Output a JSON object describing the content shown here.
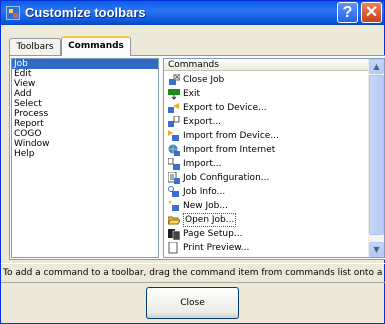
{
  "window": {
    "title": "Customize toolbars",
    "help_glyph": "?",
    "close_glyph": "✕"
  },
  "tabs": [
    {
      "label": "Toolbars",
      "selected": false
    },
    {
      "label": "Commands",
      "selected": true
    }
  ],
  "categories": {
    "items": [
      "Job",
      "Edit",
      "View",
      "Add",
      "Select",
      "Process",
      "Report",
      "COGO",
      "Window",
      "Help"
    ],
    "selected": "Job"
  },
  "commands": {
    "header": "Commands",
    "items": [
      {
        "label": "Close Job",
        "icon": "close-job-icon"
      },
      {
        "label": "Exit",
        "icon": "exit-icon"
      },
      {
        "label": "Export to Device...",
        "icon": "export-to-device-icon"
      },
      {
        "label": "Export...",
        "icon": "export-icon"
      },
      {
        "label": "Import from Device...",
        "icon": "import-from-device-icon"
      },
      {
        "label": "Import from Internet",
        "icon": "import-from-internet-icon"
      },
      {
        "label": "Import...",
        "icon": "import-icon"
      },
      {
        "label": "Job Configuration...",
        "icon": "job-configuration-icon"
      },
      {
        "label": "Job Info...",
        "icon": "job-info-icon"
      },
      {
        "label": "New Job...",
        "icon": "new-job-icon"
      },
      {
        "label": "Open Job...",
        "icon": "open-folder-icon"
      },
      {
        "label": "Page Setup...",
        "icon": "page-setup-icon"
      },
      {
        "label": "Print Preview...",
        "icon": "print-preview-icon"
      }
    ],
    "focused": "Open Job..."
  },
  "scrollbar": {
    "up_glyph": "▲",
    "down_glyph": "▼"
  },
  "hint": "To add a command to a toolbar, drag the command item from commands list onto a toolbar.",
  "buttons": {
    "close": "Close"
  },
  "colors": {
    "title_bar": "#0a5ee9",
    "selection": "#316ac5",
    "close_red": "#c8401a",
    "dialog_bg": "#ece9d8"
  }
}
